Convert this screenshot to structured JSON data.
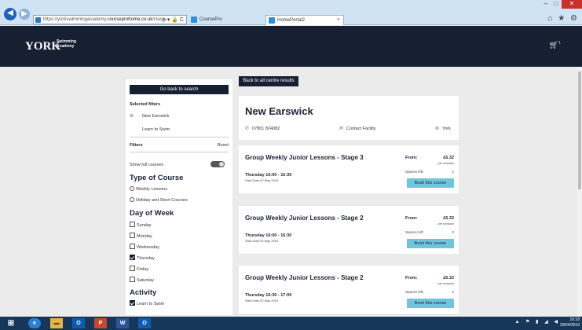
{
  "browser": {
    "url_prefix": "https://yorkswimmingacademy.",
    "url_domain": "courseprohome.co.uk",
    "url_suffix": "/class-",
    "addr_tools": "ρ ▾ 🔒 C",
    "tabs": [
      {
        "label": "CoursePro",
        "active": false
      },
      {
        "label": "HomePortal2",
        "active": true
      }
    ],
    "tab_close": "×",
    "window_controls": {
      "minimize": "–",
      "maximize": "□",
      "close": "✕"
    },
    "tool_icons": "⌂ ★ ⚙"
  },
  "header": {
    "logo_main": "YORK",
    "logo_sub_line1": "Swimming",
    "logo_sub_line2": "Academy",
    "cart_count": "1"
  },
  "sidebar": {
    "back_to_search": "Go back to search",
    "selected_filters_label": "Selected filters",
    "selected_location": "New Earswick",
    "selected_activity": "Learn to Swim",
    "filters_label": "Filters",
    "reset_label": "Reset",
    "show_full_courses": "Show full courses",
    "type_heading": "Type of Course",
    "type_options": [
      "Weekly Lessons",
      "Holiday and Short Courses"
    ],
    "day_heading": "Day of Week",
    "day_options": [
      {
        "label": "Sunday",
        "checked": false
      },
      {
        "label": "Monday",
        "checked": false
      },
      {
        "label": "Wednesday",
        "checked": false
      },
      {
        "label": "Thursday",
        "checked": true
      },
      {
        "label": "Friday",
        "checked": false
      },
      {
        "label": "Saturday",
        "checked": false
      }
    ],
    "activity_heading": "Activity",
    "activity_options": [
      {
        "label": "Learn to Swim",
        "checked": true
      }
    ]
  },
  "main": {
    "back_to_centres": "Back to all centre results",
    "centre": {
      "name": "New Earswick",
      "phone": "07801 824082",
      "contact": "Contact Facility",
      "location": "York"
    },
    "courses": [
      {
        "title": "Group Weekly Junior Lessons - Stage 3",
        "time": "Thursday 16:00 - 16:30",
        "start": "Start Date 02 May 2019",
        "from_label": "From:",
        "price": "£6.32",
        "per": "per session",
        "spaces_label": "Spaces left:",
        "spaces": "2",
        "book": "Book this course"
      },
      {
        "title": "Group Weekly Junior Lessons - Stage 2",
        "time": "Thursday 16:00 - 16:30",
        "start": "Start Date 02 May 2019",
        "from_label": "From:",
        "price": "£6.32",
        "per": "per session",
        "spaces_label": "Spaces left:",
        "spaces": "3",
        "book": "Book this course"
      },
      {
        "title": "Group Weekly Junior Lessons - Stage 2",
        "time": "Thursday 16:30 - 17:00",
        "start": "Start Date 02 May 2019",
        "from_label": "From:",
        "price": "£6.32",
        "per": "per session",
        "spaces_label": "Spaces left:",
        "spaces": "2",
        "book": "Book this course"
      }
    ]
  },
  "taskbar": {
    "start": "⊞",
    "apps": [
      "e",
      "▬",
      "O",
      "P",
      "W",
      "O"
    ],
    "tray": "▲ ⚑ ▮ ◢ ◀",
    "time": "16:18",
    "date": "29/04/2019"
  }
}
